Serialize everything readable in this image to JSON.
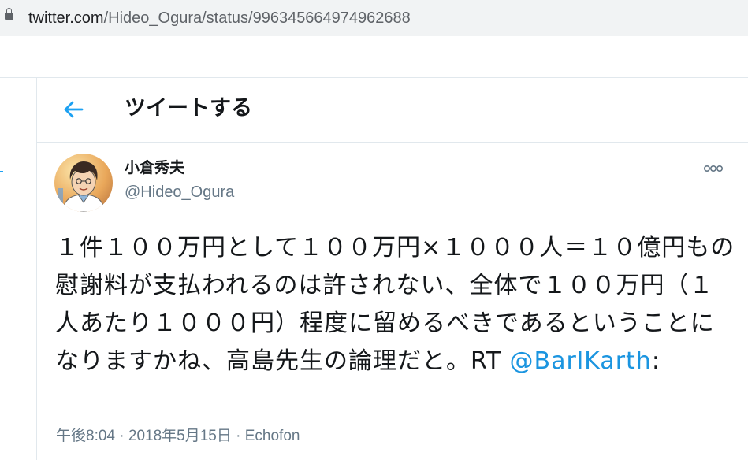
{
  "browser": {
    "url_host": "twitter.com",
    "url_path": "/Hideo_Ogura/status/996345664974962688"
  },
  "header": {
    "title": "ツイートする",
    "back_icon": "arrow-left-icon"
  },
  "tweet": {
    "display_name": "小倉秀夫",
    "handle": "@Hideo_Ogura",
    "text_main": "１件１００万円として１００万円×１０００人＝１０億円もの慰謝料が支払われるのは許されない、全体で１００万円（１人あたり１０００円）程度に留めるべきであるということになりますかね、高島先生の論理だと。RT ",
    "mention": "@BarlKarth",
    "text_tail": ":",
    "time": "午後8:04",
    "date": "2018年5月15日",
    "separator": "·",
    "source": "Echofon",
    "more_icon": "more-dots-icon"
  },
  "colors": {
    "accent": "#1da1f2",
    "link": "#1b95e0",
    "text": "#14171a",
    "secondary": "#657786",
    "border": "#e1e8ed"
  }
}
